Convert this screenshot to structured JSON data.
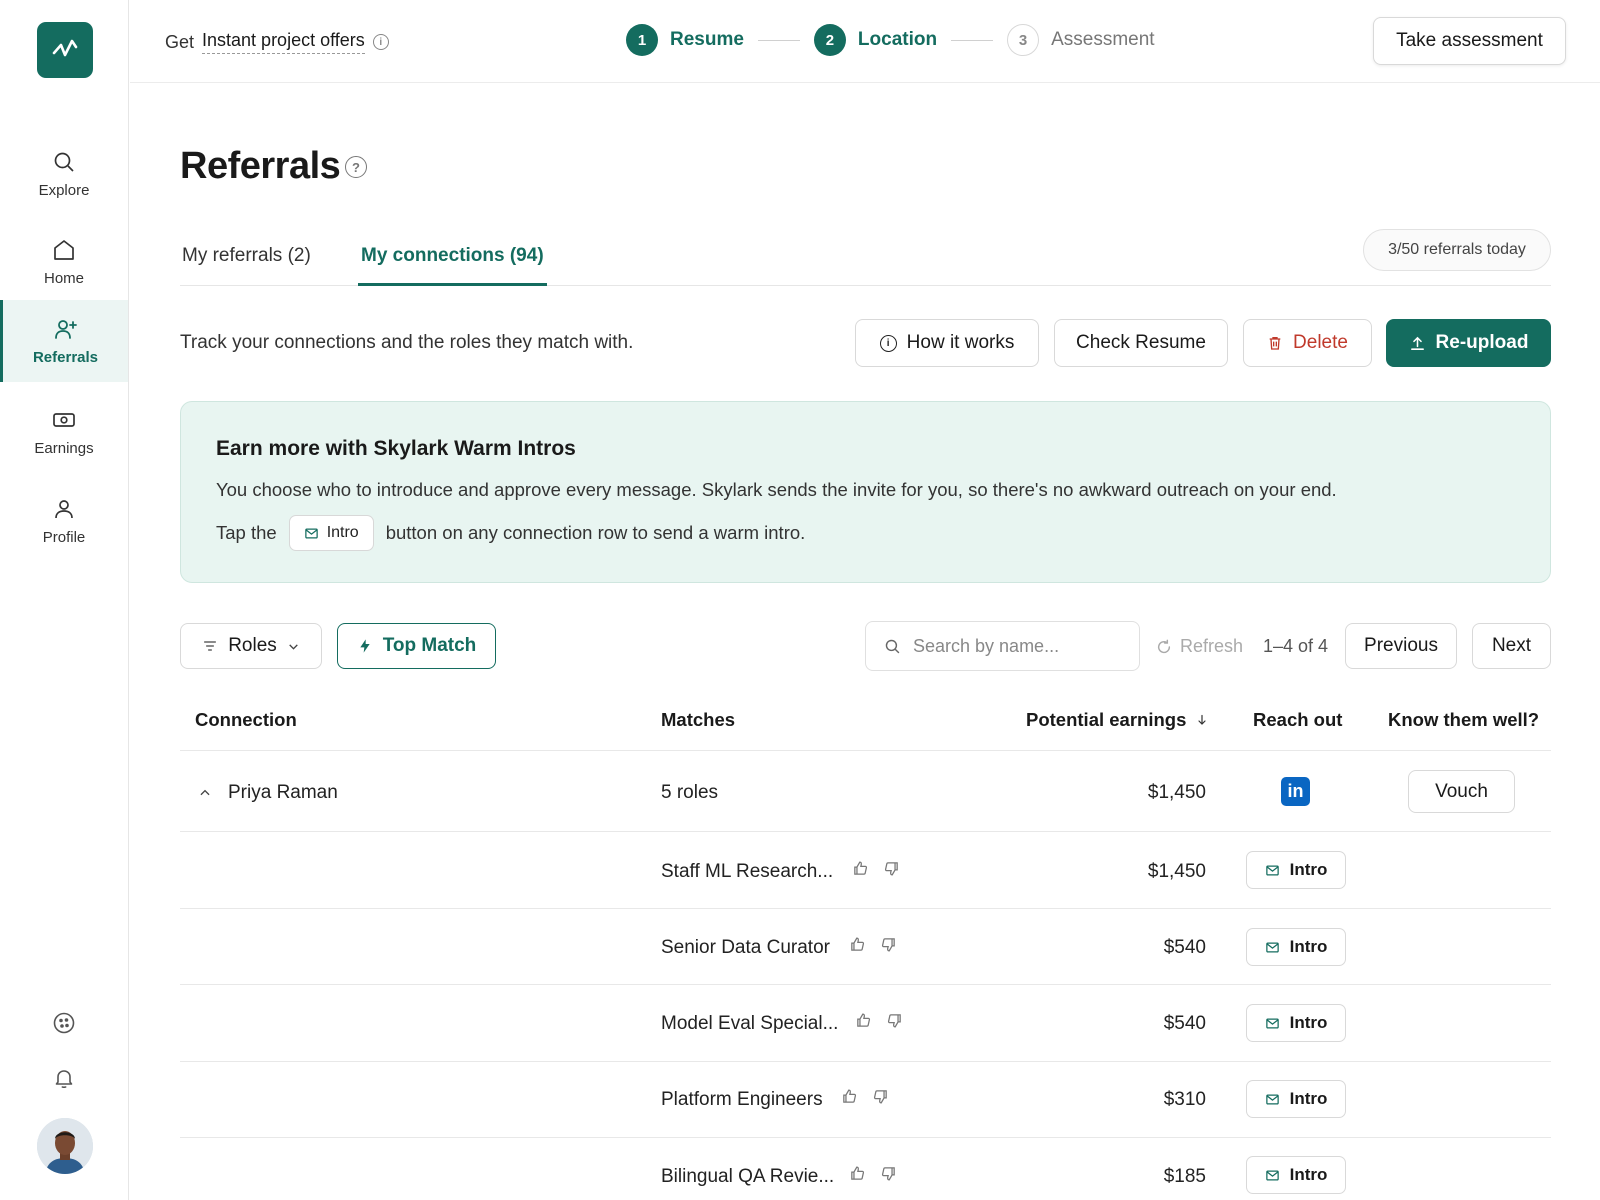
{
  "sidebar": {
    "items": [
      {
        "label": "Explore"
      },
      {
        "label": "Home"
      },
      {
        "label": "Referrals"
      },
      {
        "label": "Earnings"
      },
      {
        "label": "Profile"
      }
    ],
    "active": "Referrals"
  },
  "topbar": {
    "get_prefix": "Get",
    "offers_link": "Instant project offers",
    "steps": [
      {
        "num": "1",
        "label": "Resume",
        "state": "done"
      },
      {
        "num": "2",
        "label": "Location",
        "state": "done"
      },
      {
        "num": "3",
        "label": "Assessment",
        "state": "todo"
      }
    ],
    "take_assessment": "Take assessment"
  },
  "page": {
    "title": "Referrals",
    "tabs": [
      {
        "label": "My referrals (2)"
      },
      {
        "label": "My connections (94)"
      }
    ],
    "quota": "3/50 referrals today",
    "subtitle": "Track your connections and the roles they match with.",
    "actions": {
      "how": "How it works",
      "check": "Check Resume",
      "delete": "Delete",
      "reupload": "Re-upload"
    }
  },
  "banner": {
    "heading": "Earn more with Skylark Warm Intros",
    "body": "You choose who to introduce and approve every message. Skylark sends the invite for you, so there's no awkward outreach on your end.",
    "tap_prefix": "Tap the",
    "chip": "Intro",
    "tap_suffix": "button on any connection row to send a warm intro."
  },
  "filters": {
    "roles": "Roles",
    "top_match": "Top Match",
    "search_placeholder": "Search by name...",
    "refresh": "Refresh",
    "range": "1–4 of 4",
    "previous": "Previous",
    "next": "Next"
  },
  "table": {
    "headers": {
      "connection": "Connection",
      "matches": "Matches",
      "earnings": "Potential earnings",
      "reach": "Reach out",
      "know": "Know them well?"
    },
    "connection": {
      "name": "Priya Raman",
      "matches": "5 roles",
      "earnings": "$1,450",
      "linkedin": "in",
      "vouch": "Vouch"
    },
    "roles": [
      {
        "title": "Staff ML Research...",
        "earnings": "$1,450",
        "action": "Intro"
      },
      {
        "title": "Senior Data Curator",
        "earnings": "$540",
        "action": "Intro"
      },
      {
        "title": "Model Eval Special...",
        "earnings": "$540",
        "action": "Intro"
      },
      {
        "title": "Platform Engineers",
        "earnings": "$310",
        "action": "Intro"
      },
      {
        "title": "Bilingual QA Revie...",
        "earnings": "$185",
        "action": "Intro"
      }
    ]
  },
  "colors": {
    "brand": "#146c5f",
    "danger": "#c0392b",
    "banner_bg": "#e8f5f1",
    "linkedin": "#0a66c2"
  }
}
